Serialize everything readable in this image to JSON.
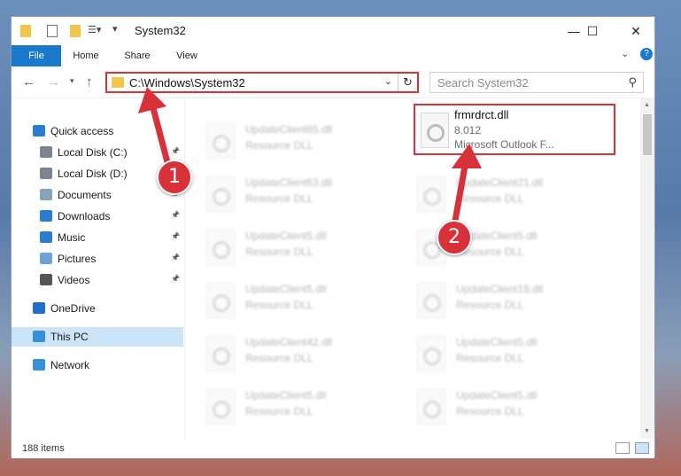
{
  "window": {
    "title": "System32",
    "controls": {
      "minimize": "—",
      "maximize": "☐",
      "close": "✕"
    }
  },
  "ribbon": {
    "tabs": [
      "File",
      "Home",
      "Share",
      "View"
    ],
    "expand": "⌄",
    "help": "?"
  },
  "address_bar": {
    "path": "C:\\Windows\\System32",
    "dropdown": "⌄",
    "refresh": "↻"
  },
  "search": {
    "placeholder": "Search System32"
  },
  "sidebar": {
    "items": [
      {
        "label": "Quick access",
        "icon": "star-icon",
        "pinned": false
      },
      {
        "label": "Local Disk (C:)",
        "icon": "drive-icon",
        "pinned": true
      },
      {
        "label": "Local Disk (D:)",
        "icon": "drive-icon",
        "pinned": false
      },
      {
        "label": "Documents",
        "icon": "documents-icon",
        "pinned": true
      },
      {
        "label": "Downloads",
        "icon": "download-icon",
        "pinned": true
      },
      {
        "label": "Music",
        "icon": "music-icon",
        "pinned": true
      },
      {
        "label": "Pictures",
        "icon": "pictures-icon",
        "pinned": true
      },
      {
        "label": "Videos",
        "icon": "videos-icon",
        "pinned": true
      },
      {
        "label": "OneDrive",
        "icon": "cloud-icon",
        "pinned": false
      },
      {
        "label": "This PC",
        "icon": "pc-icon",
        "pinned": false,
        "selected": true
      },
      {
        "label": "Network",
        "icon": "network-icon",
        "pinned": false
      }
    ]
  },
  "files": {
    "highlighted": {
      "name": "frmrdrct.dll",
      "size": "8.012",
      "description": "Microsoft Outlook F..."
    },
    "blurred": [
      {
        "name": "UpdateClient65.dll",
        "type": "Resource DLL"
      },
      {
        "name": "UpdateClient63.dll",
        "type": "Resource DLL"
      },
      {
        "name": "UpdateClient21.dll",
        "type": "Resource DLL"
      },
      {
        "name": "UpdateClient5.dll",
        "type": "Resource DLL"
      },
      {
        "name": "UpdateClient5.dll",
        "type": "Resource DLL"
      },
      {
        "name": "UpdateClient5.dll",
        "type": "Resource DLL"
      },
      {
        "name": "UpdateClient19.dll",
        "type": "Resource DLL"
      },
      {
        "name": "UpdateClient42.dll",
        "type": "Resource DLL"
      },
      {
        "name": "UpdateClient5.dll",
        "type": "Resource DLL"
      },
      {
        "name": "UpdateClient5.dll",
        "type": "Resource DLL"
      },
      {
        "name": "UpdateClient5.dll",
        "type": "Resource DLL"
      },
      {
        "name": "UpdateClient5.dll",
        "type": "Resource DLL"
      }
    ]
  },
  "status": {
    "item_count": "188 items"
  },
  "callouts": {
    "step1": "1",
    "step2": "2"
  },
  "colors": {
    "accent": "#1979ca",
    "callout": "#d9313a",
    "selected": "#cce4f7"
  }
}
